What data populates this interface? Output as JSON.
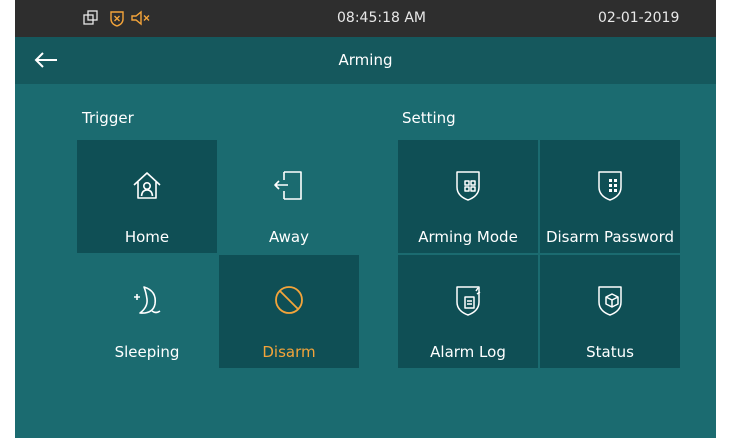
{
  "statusbar": {
    "time": "08:45:18   AM",
    "date": "02-01-2019"
  },
  "header": {
    "title": "Arming"
  },
  "trigger": {
    "label": "Trigger",
    "items": [
      {
        "label": "Home",
        "icon": "home-icon"
      },
      {
        "label": "Away",
        "icon": "door-exit-icon"
      },
      {
        "label": "Sleeping",
        "icon": "moon-icon"
      },
      {
        "label": "Disarm",
        "icon": "prohibited-icon",
        "active": true
      }
    ]
  },
  "setting": {
    "label": "Setting",
    "items": [
      {
        "label": "Arming Mode",
        "icon": "shield-grid-icon"
      },
      {
        "label": "Disarm Password",
        "icon": "shield-keypad-icon"
      },
      {
        "label": "Alarm Log",
        "icon": "shield-document-icon"
      },
      {
        "label": "Status",
        "icon": "shield-cube-icon"
      }
    ]
  },
  "colors": {
    "accent": "#f3a43a",
    "background": "#1b6b70",
    "tile": "#0f4f55",
    "header": "#15585d",
    "statusbar": "#2e2e2e"
  }
}
